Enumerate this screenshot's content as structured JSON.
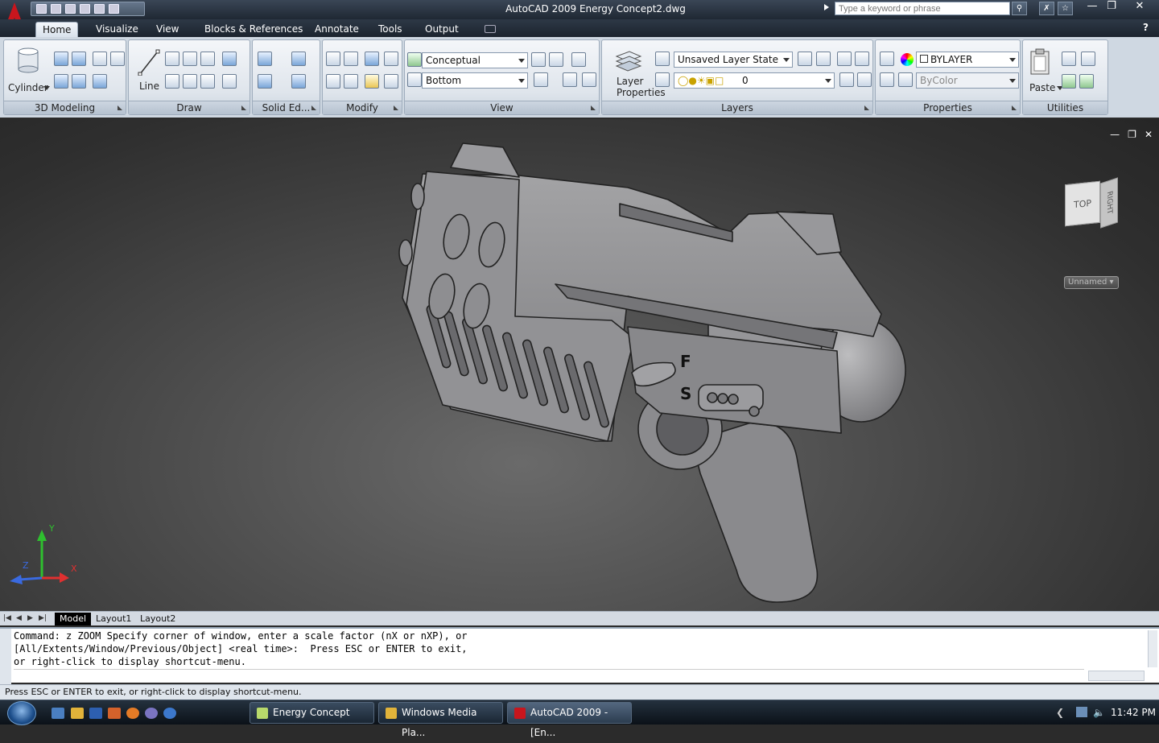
{
  "window": {
    "title": "AutoCAD 2009 Energy Concept2.dwg"
  },
  "search": {
    "placeholder": "Type a keyword or phrase"
  },
  "tabs": [
    "Home",
    "Visualize",
    "View",
    "Blocks & References",
    "Annotate",
    "Tools",
    "Output"
  ],
  "panels": {
    "modeling": {
      "title": "3D Modeling",
      "cylinder_label": "Cylinder"
    },
    "draw": {
      "title": "Draw",
      "line_label": "Line"
    },
    "solid_editing": {
      "title": "Solid Ed..."
    },
    "modify": {
      "title": "Modify"
    },
    "view": {
      "title": "View",
      "visual_style": "Conceptual",
      "view_direction": "Bottom"
    },
    "layers": {
      "title": "Layers",
      "layer_properties_label": "Layer Properties",
      "layer_state": "Unsaved Layer State",
      "current_layer": "0"
    },
    "properties": {
      "title": "Properties",
      "color": "BYLAYER",
      "linetype": "ByColor"
    },
    "utilities": {
      "title": "Utilities",
      "paste_label": "Paste"
    }
  },
  "viewport": {
    "viewcube_top": "TOP",
    "viewcube_right": "RIGHT",
    "ucs_menu": "Unnamed",
    "fire_mode_labels": [
      "F",
      "S"
    ],
    "axes": {
      "x": "X",
      "y": "Y",
      "z": "Z"
    }
  },
  "layout_tabs": [
    "Model",
    "Layout1",
    "Layout2"
  ],
  "command_lines": [
    "Command: z ZOOM Specify corner of window, enter a scale factor (nX or nXP), or",
    "[All/Extents/Window/Previous/Object] <real time>:  Press ESC or ENTER to exit,",
    "or right-click to display shortcut-menu."
  ],
  "status_text": "Press ESC or ENTER to exit, or right-click to display shortcut-menu.",
  "taskbar": {
    "tasks": [
      "Energy Concept",
      "Windows Media Pla...",
      "AutoCAD 2009 - [En..."
    ],
    "clock": "11:42 PM"
  },
  "colors": {
    "accent": "#c8161d",
    "viewport_bg": "#4a4a4a",
    "model_gray": "#8c8c8e"
  }
}
